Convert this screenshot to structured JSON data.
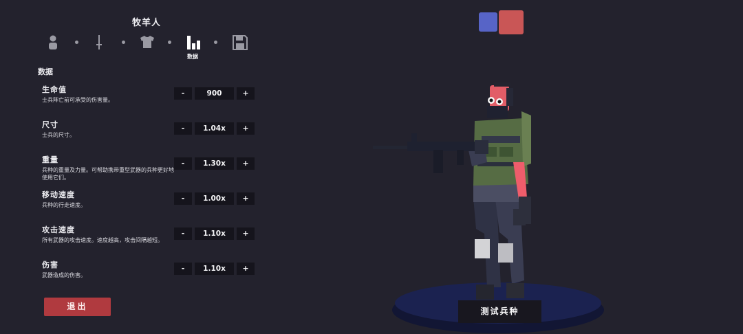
{
  "unit_name": "牧羊人",
  "tabs": {
    "items": [
      {
        "icon": "person-icon"
      },
      {
        "icon": "sword-icon"
      },
      {
        "icon": "shirt-icon"
      },
      {
        "icon": "stats-icon",
        "label": "数据",
        "active": true
      },
      {
        "icon": "save-icon"
      }
    ]
  },
  "section_title": "数据",
  "stats": [
    {
      "name": "生命值",
      "desc": "士兵阵亡前可承受的伤害量。",
      "value": "900"
    },
    {
      "name": "尺寸",
      "desc": "士兵的尺寸。",
      "value": "1.04x"
    },
    {
      "name": "重量",
      "desc": "兵种的重量及力量。可帮助携带重型武器的兵种更好地使用它们。",
      "value": "1.30x"
    },
    {
      "name": "移动速度",
      "desc": "兵种的行走速度。",
      "value": "1.00x"
    },
    {
      "name": "攻击速度",
      "desc": "所有武器的攻击速度。速度越高，攻击间隔越短。",
      "value": "1.10x"
    },
    {
      "name": "伤害",
      "desc": "武器造成的伤害。",
      "value": "1.10x"
    }
  ],
  "stepper": {
    "minus": "-",
    "plus": "+"
  },
  "exit_label": "退出",
  "test_label": "测试兵种",
  "colors": {
    "team_blue": "#5764c7",
    "team_red": "#c95656",
    "exit": "#b03a3f",
    "background": "#23222d"
  }
}
